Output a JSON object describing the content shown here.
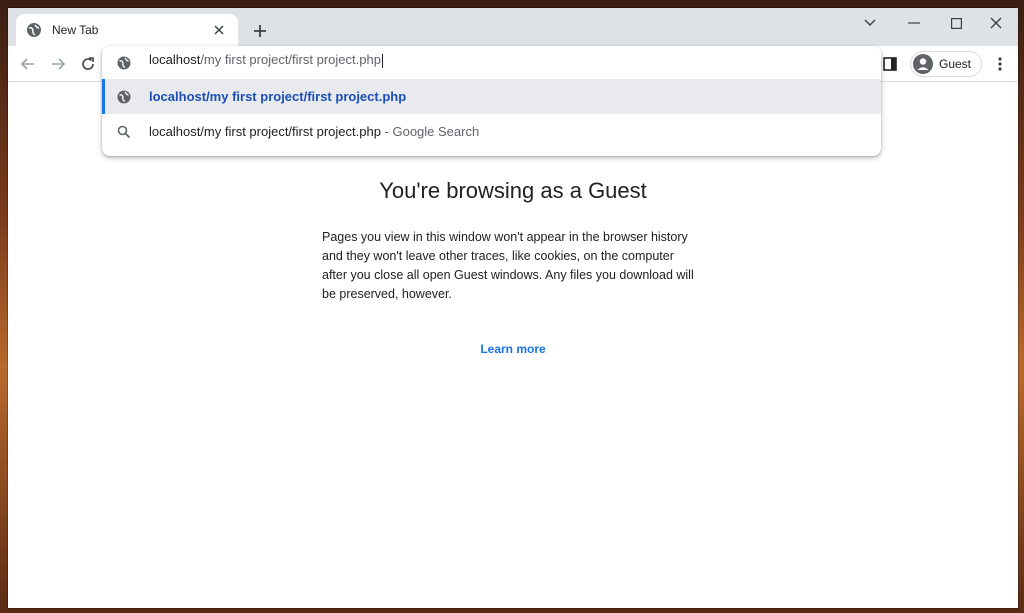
{
  "tab": {
    "title": "New Tab",
    "favicon": "globe-icon"
  },
  "window_controls": [
    "chevron-down-icon",
    "minimize-icon",
    "maximize-icon",
    "close-icon"
  ],
  "toolbar": {
    "profile_label": "Guest"
  },
  "omnibox": {
    "input_host": "localhost",
    "input_path": "/my first project/first project.php",
    "suggestions": [
      {
        "text": "localhost/my first project/first project.php",
        "icon": "globe-icon"
      },
      {
        "text": "localhost/my first project/first project.php",
        "suffix": " - Google Search",
        "icon": "search-icon"
      }
    ]
  },
  "page": {
    "heading": "You're browsing as a Guest",
    "line1": "Pages you view in this window won't appear in the browser history",
    "line2": "and they won't leave other traces, like cookies, on the computer",
    "line3": "after you close all open Guest windows. Any files you download will",
    "line4": "be preserved, however.",
    "learn_more": "Learn more"
  },
  "colors": {
    "accent": "#1a73e8",
    "tabstrip": "#dee1e6"
  }
}
